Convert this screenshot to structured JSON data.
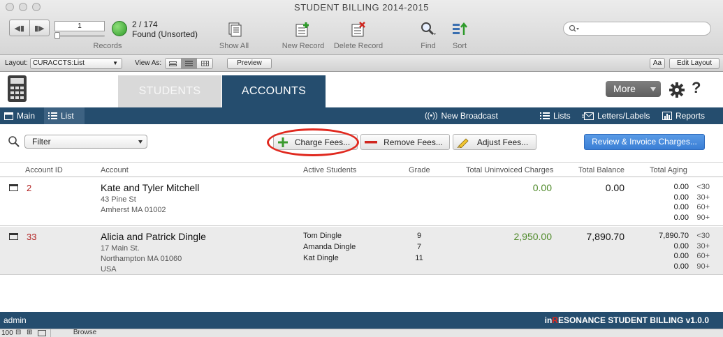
{
  "window": {
    "title": "STUDENT BILLING 2014-2015"
  },
  "toolbar": {
    "record_number": "1",
    "records_label": "Records",
    "found_count": "2 / 174",
    "found_status": "Found (Unsorted)",
    "show_all": "Show All",
    "new_record": "New Record",
    "delete_record": "Delete Record",
    "find": "Find",
    "sort": "Sort"
  },
  "layoutbar": {
    "layout_label": "Layout:",
    "layout_value": "CURACCTS:List",
    "view_as_label": "View As:",
    "preview": "Preview",
    "font_btn": "Aa",
    "edit_layout": "Edit Layout"
  },
  "tabs": {
    "students": "STUDENTS",
    "accounts": "ACCOUNTS"
  },
  "header": {
    "more": "More",
    "help": "?"
  },
  "navbar": {
    "main": "Main",
    "list": "List",
    "new_broadcast": "New Broadcast",
    "lists": "Lists",
    "letters_labels": "Letters/Labels",
    "reports": "Reports"
  },
  "actions": {
    "filter": "Filter",
    "charge_fees": "Charge Fees...",
    "remove_fees": "Remove Fees...",
    "adjust_fees": "Adjust Fees...",
    "review_invoice": "Review & Invoice Charges..."
  },
  "table": {
    "headers": [
      "Account ID",
      "Account",
      "Active Students",
      "Grade",
      "Total Uninvoiced Charges",
      "Total Balance",
      "Total Aging"
    ],
    "aging_labels": [
      "<30",
      "30+",
      "60+",
      "90+"
    ],
    "rows": [
      {
        "id": "2",
        "name": "Kate and Tyler Mitchell",
        "address": [
          "43 Pine St",
          "Amherst MA 01002"
        ],
        "students": [],
        "grades": [],
        "uninvoiced": "0.00",
        "balance": "0.00",
        "aging": [
          "0.00",
          "0.00",
          "0.00",
          "0.00"
        ]
      },
      {
        "id": "33",
        "name": "Alicia and Patrick Dingle",
        "address": [
          "17 Main St.",
          "Northampton MA 01060",
          "USA"
        ],
        "students": [
          "Tom Dingle",
          "Amanda Dingle",
          "Kat Dingle"
        ],
        "grades": [
          "9",
          "7",
          "11"
        ],
        "uninvoiced": "2,950.00",
        "balance": "7,890.70",
        "aging": [
          "7,890.70",
          "0.00",
          "0.00",
          "0.00"
        ]
      }
    ]
  },
  "footer": {
    "user": "admin",
    "brand_prefix": "in",
    "brand_highlight": "R",
    "brand_rest": "ESONANCE STUDENT BILLING v1.0.0"
  },
  "statusbar": {
    "zoom": "100",
    "mode": "Browse"
  },
  "colors": {
    "navy": "#254d6e",
    "accent_red": "#e0291f",
    "charge_green": "#4f8a2a",
    "review_blue": "#3a7ed5"
  }
}
